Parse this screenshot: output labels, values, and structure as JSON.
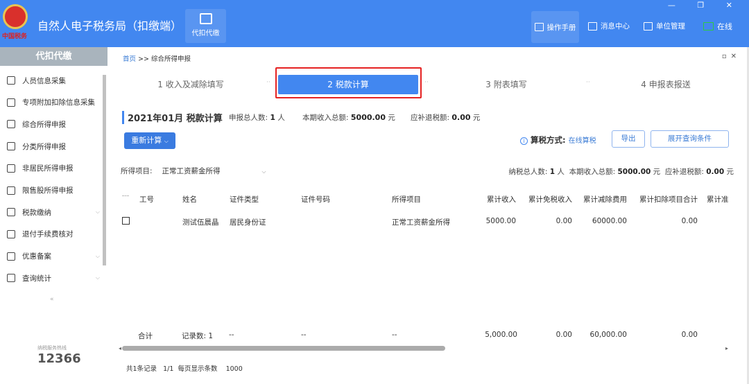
{
  "header": {
    "logo_text": "中国税务",
    "app_title": "自然人电子税务局（扣缴端）",
    "module_tab": "代扣代缴",
    "actions": [
      {
        "label": "操作手册",
        "icon": "manual-icon"
      },
      {
        "label": "消息中心",
        "icon": "mail-icon"
      },
      {
        "label": "单位管理",
        "icon": "building-icon"
      },
      {
        "label": "在线",
        "icon": "online-monitor-icon",
        "color": "#2ecc40"
      }
    ],
    "window_controls": "— ❐ ✕"
  },
  "sidebar": {
    "title": "代扣代缴",
    "items": [
      {
        "label": "人员信息采集",
        "icon": "user-add-icon"
      },
      {
        "label": "专项附加扣除信息采集",
        "icon": "list-icon"
      },
      {
        "label": "综合所得申报",
        "icon": "layers-icon"
      },
      {
        "label": "分类所得申报",
        "icon": "pie-icon"
      },
      {
        "label": "非居民所得申报",
        "icon": "user-icon"
      },
      {
        "label": "限售股所得申报",
        "icon": "bar-chart-icon"
      },
      {
        "label": "税款缴纳",
        "icon": "folder-icon",
        "expandable": true
      },
      {
        "label": "退付手续费核对",
        "icon": "doc-check-icon"
      },
      {
        "label": "优惠备案",
        "icon": "file-icon",
        "expandable": true
      },
      {
        "label": "查询统计",
        "icon": "search-list-icon",
        "expandable": true
      }
    ],
    "collapse": "«",
    "hotline": "12366",
    "hotline_caption": "纳税服务热线"
  },
  "breadcrumb": {
    "home": "首页",
    "sep": ">>",
    "current": "综合所得申报"
  },
  "steps": [
    {
      "label": "1 收入及减除填写"
    },
    {
      "label": "2 税款计算",
      "active": true
    },
    {
      "label": "3 附表填写"
    },
    {
      "label": "4 申报表报送"
    }
  ],
  "summary": {
    "title": "2021年01月 税款计算",
    "people_label": "申报总人数:",
    "people": "1",
    "people_unit": "人",
    "income_label": "本期收入总额:",
    "income": "5000.00",
    "income_unit": "元",
    "tax_label": "应补退税额:",
    "tax": "0.00",
    "tax_unit": "元"
  },
  "toolbar": {
    "recalc": "重新计算",
    "method_label": "算税方式:",
    "method_value": "在线算税",
    "export": "导出",
    "expand": "展开查询条件"
  },
  "filter": {
    "label": "所得项目:",
    "value": "正常工资薪金所得"
  },
  "stats2": {
    "people_label": "纳税总人数:",
    "people": "1",
    "unit_p": "人",
    "income_label": "本期收入总额:",
    "income": "5000.00",
    "unit_y": "元",
    "tax_label": "应补退税额:",
    "tax": "0.00",
    "unit_t": "元"
  },
  "table": {
    "columns": [
      "工号",
      "姓名",
      "证件类型",
      "证件号码",
      "所得项目",
      "累计收入",
      "累计免税收入",
      "累计减除费用",
      "累计扣除项目合计",
      "累计准"
    ],
    "rows": [
      [
        "",
        "测试伍晨晶",
        "居民身份证",
        "",
        "正常工资薪金所得",
        "5000.00",
        "0.00",
        "60000.00",
        "0.00",
        ""
      ]
    ],
    "total": {
      "label": "合计",
      "count": "记录数: 1",
      "c1": "--",
      "c2": "--",
      "c3": "--",
      "income": "5,000.00",
      "exempt": "0.00",
      "deduct": "60,000.00",
      "items": "0.00"
    }
  },
  "pagination": {
    "total": "共1条记录",
    "page": "1/1",
    "per_page_label": "每页显示条数",
    "per_page": "1000"
  }
}
